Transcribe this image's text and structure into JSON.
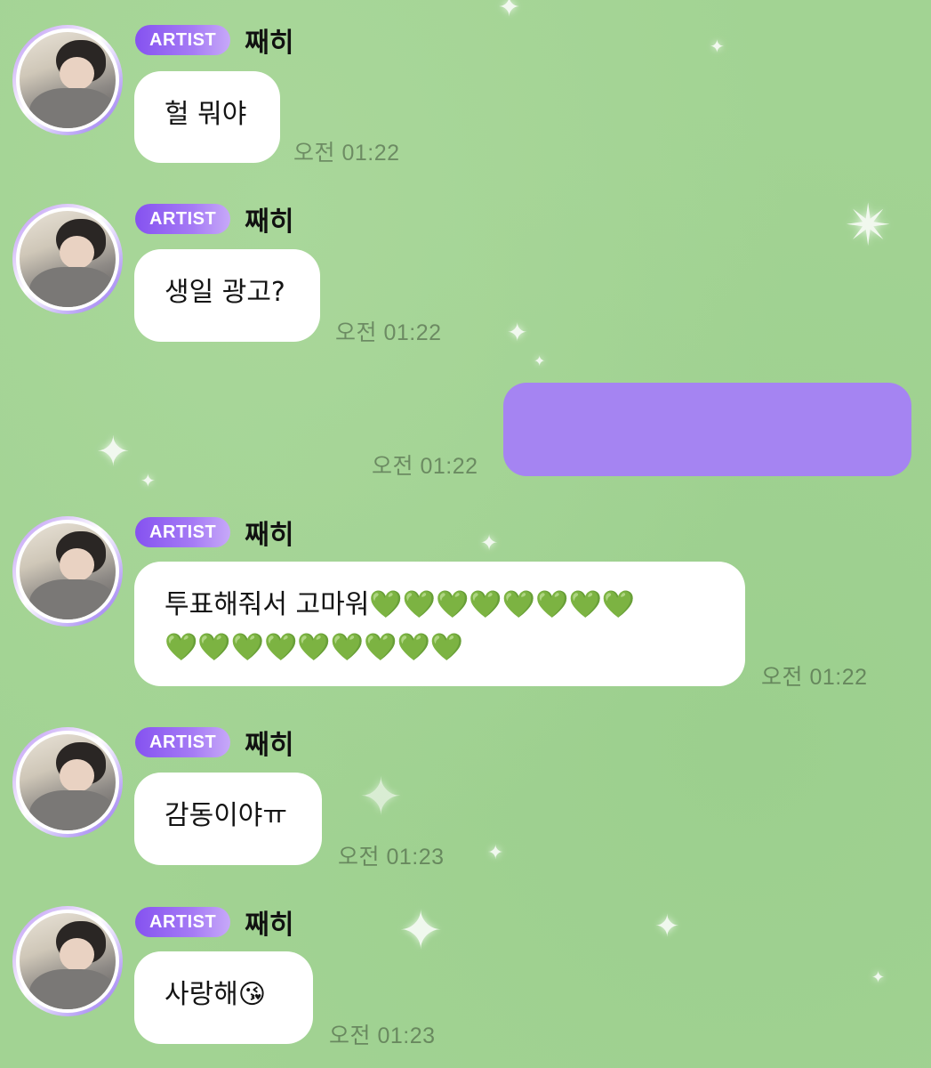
{
  "theme": {
    "background": "#a2d393",
    "badge_color": "#8552f0",
    "my_bubble_color": "#a584f2",
    "heart_color": "#33b52f"
  },
  "messages": [
    {
      "badge": "ARTIST",
      "name": "째히",
      "text": "헐 뭐야",
      "time": "오전 01:22"
    },
    {
      "badge": "ARTIST",
      "name": "째히",
      "text": "생일 광고?",
      "time": "오전 01:22"
    },
    {
      "my_text": "",
      "time": "오전 01:22"
    },
    {
      "badge": "ARTIST",
      "name": "째히",
      "text_line1": "투표해줘서 고마워💚💚💚💚💚💚💚💚",
      "text_line2": "💚💚💚💚💚💚💚💚💚",
      "time": "오전 01:22"
    },
    {
      "badge": "ARTIST",
      "name": "째히",
      "text": "감동이야ㅠ",
      "time": "오전 01:23"
    },
    {
      "badge": "ARTIST",
      "name": "째히",
      "text": "사랑해😘",
      "time": "오전 01:23"
    }
  ]
}
